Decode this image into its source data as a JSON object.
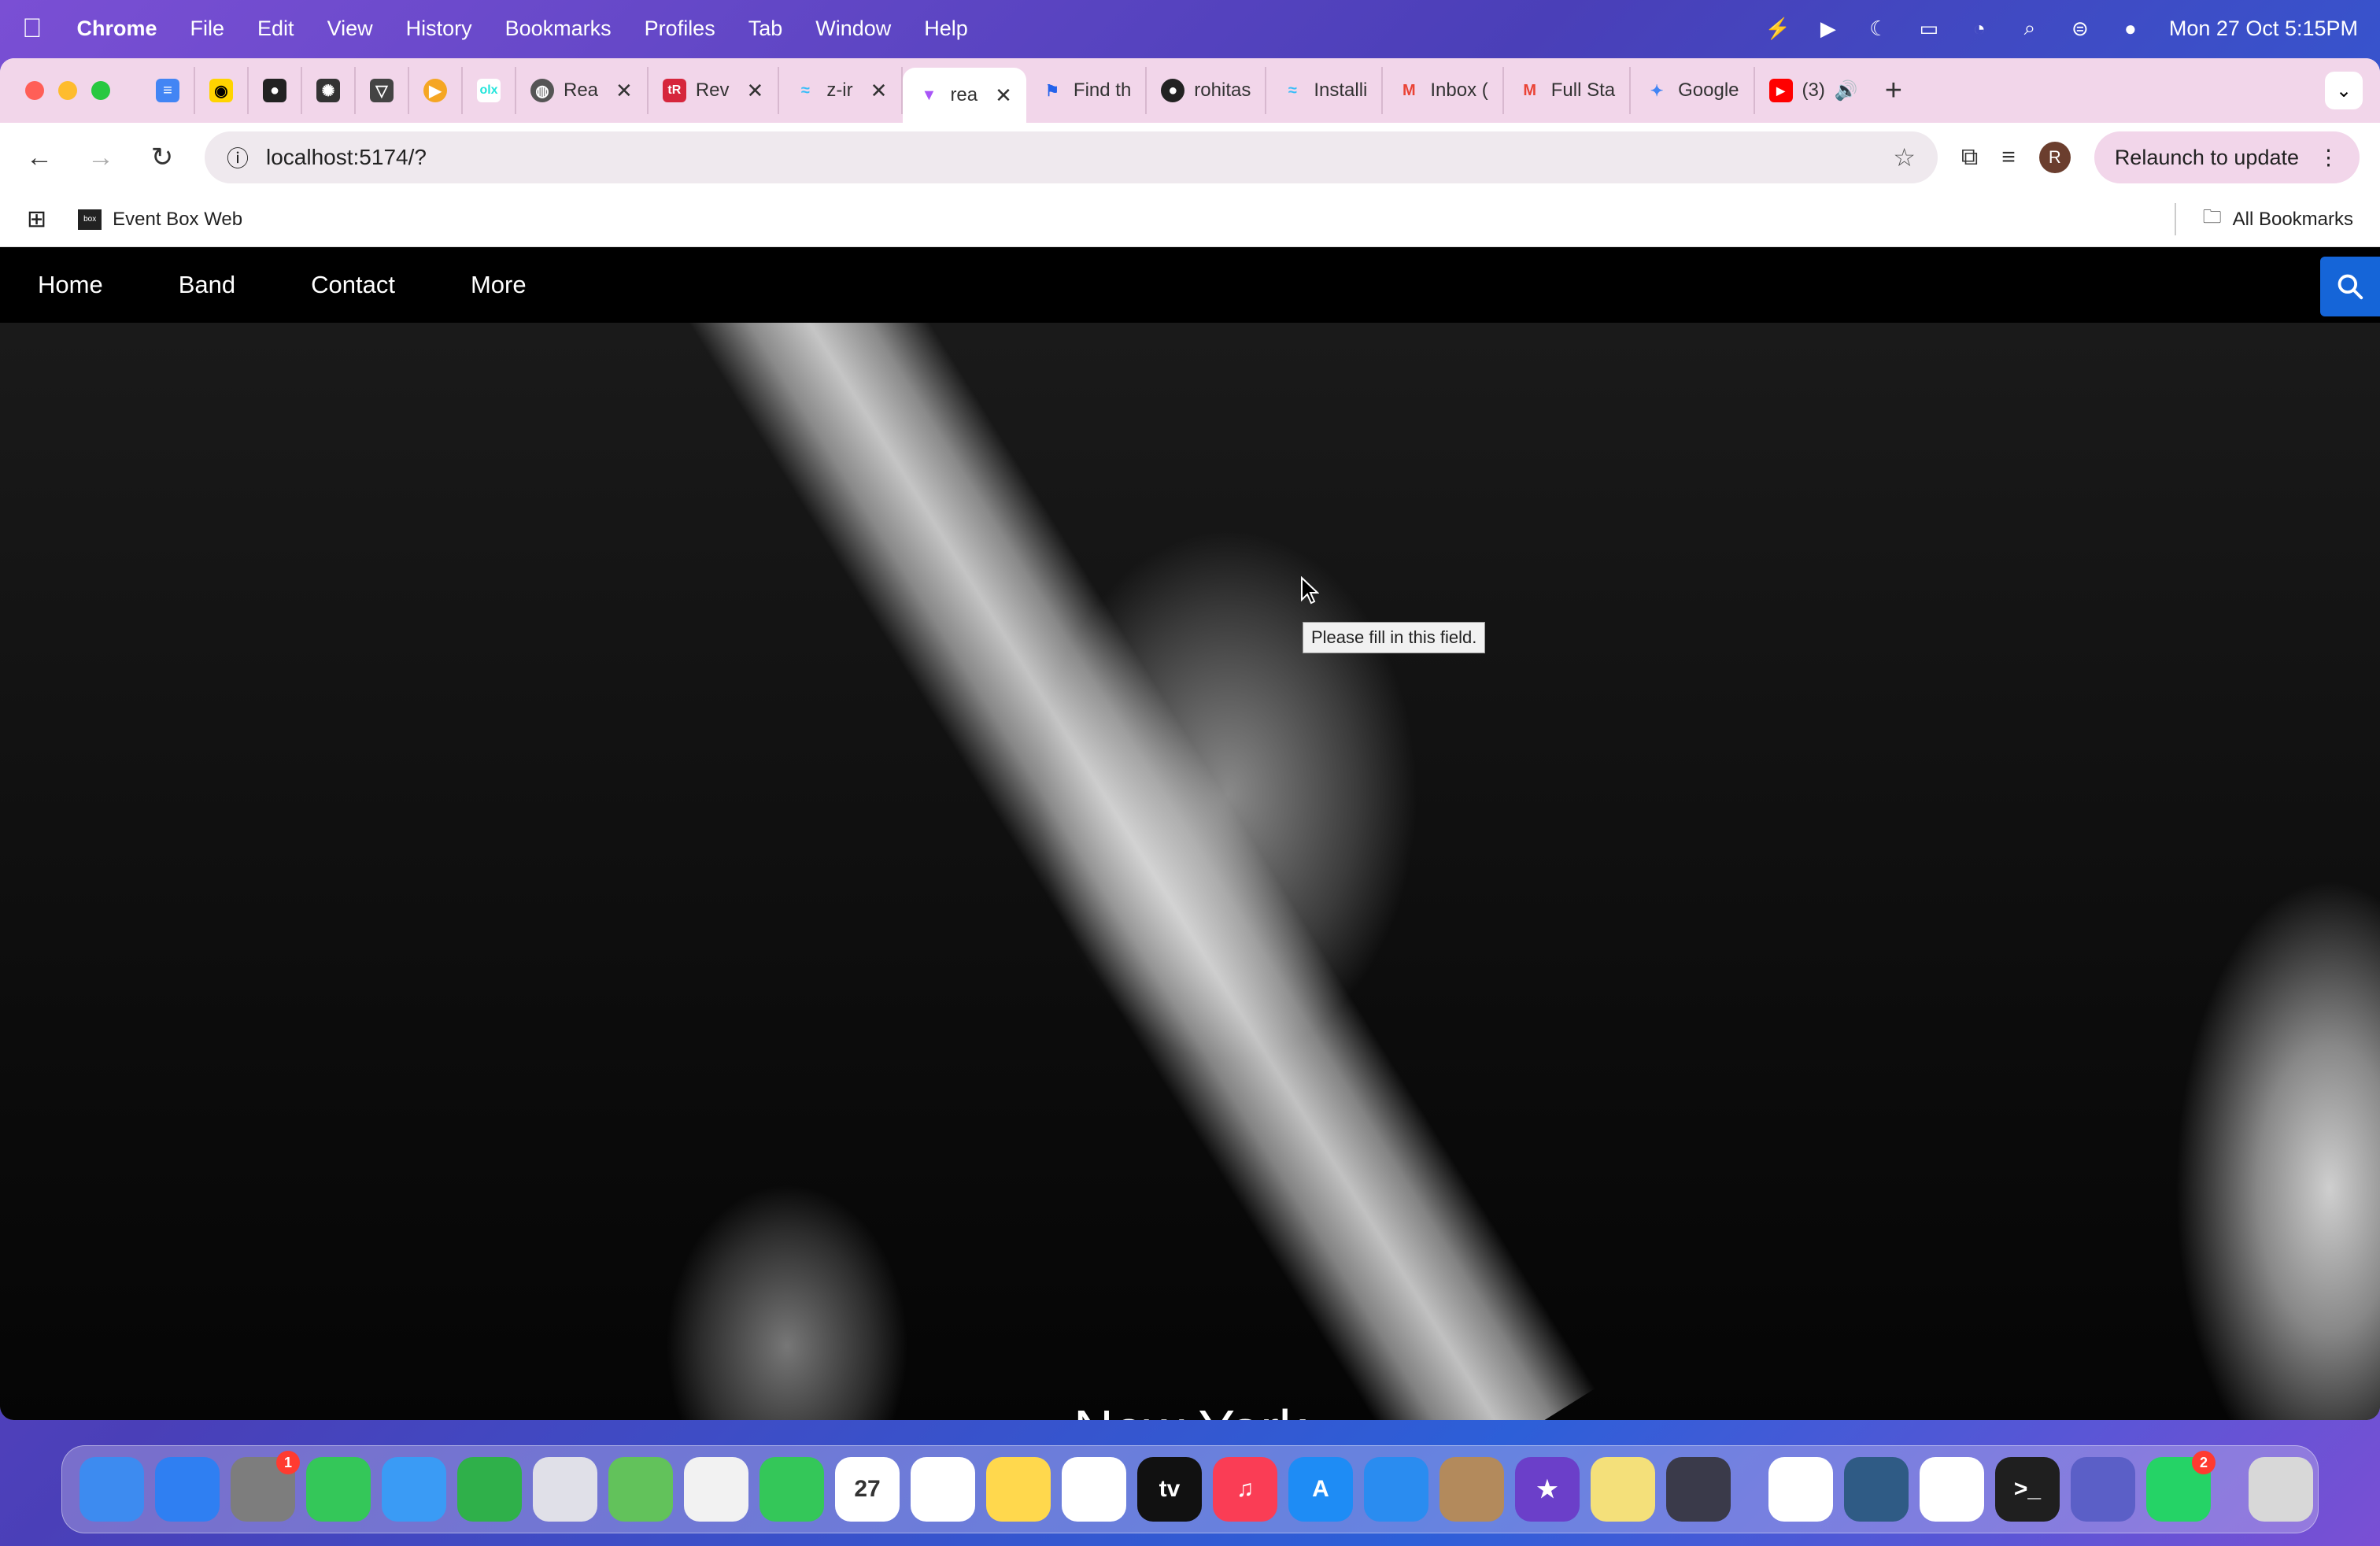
{
  "menubar": {
    "app_name": "Chrome",
    "items": [
      "File",
      "Edit",
      "View",
      "History",
      "Bookmarks",
      "Profiles",
      "Tab",
      "Window",
      "Help"
    ],
    "datetime": "Mon 27 Oct  5:15PM"
  },
  "tabs": [
    {
      "label": "",
      "icon": "docs-icon"
    },
    {
      "label": "",
      "icon": "lens-icon"
    },
    {
      "label": "",
      "icon": "github-icon"
    },
    {
      "label": "",
      "icon": "openai-icon"
    },
    {
      "label": "",
      "icon": "vercel-icon"
    },
    {
      "label": "",
      "icon": "play-icon"
    },
    {
      "label": "",
      "icon": "olx-icon"
    },
    {
      "label": "Rea",
      "icon": "globe-icon"
    },
    {
      "label": "Rev",
      "icon": "tr-icon"
    },
    {
      "label": "z-ir",
      "icon": "tailwind-icon"
    },
    {
      "label": "rea",
      "icon": "vite-icon"
    },
    {
      "label": "Find th",
      "icon": "flag-icon"
    },
    {
      "label": "rohitas",
      "icon": "github-icon"
    },
    {
      "label": "Installi",
      "icon": "tailwind-icon"
    },
    {
      "label": "Inbox (",
      "icon": "gmail-icon"
    },
    {
      "label": "Full Sta",
      "icon": "gmail-icon"
    },
    {
      "label": "Google",
      "icon": "gemini-icon"
    },
    {
      "label": "(3)",
      "icon": "youtube-icon"
    }
  ],
  "toolbar": {
    "url": "localhost:5174/?",
    "relaunch_label": "Relaunch to update",
    "avatar_letter": "R"
  },
  "bookmarks": {
    "items": [
      {
        "label": "Event Box Web"
      }
    ],
    "all_label": "All Bookmarks"
  },
  "site": {
    "nav": [
      "Home",
      "Band",
      "Contact",
      "More"
    ],
    "hero_caption": "New York",
    "tooltip": "Please fill in this field."
  },
  "dock": {
    "apps": [
      {
        "name": "finder-icon",
        "label": "",
        "color": "#3d8bf0"
      },
      {
        "name": "safari-icon",
        "label": "",
        "color": "#2f7ff2"
      },
      {
        "name": "system-settings-icon",
        "label": "",
        "color": "#7d7d7d",
        "badge": "1"
      },
      {
        "name": "messages-icon",
        "label": "",
        "color": "#34c759"
      },
      {
        "name": "mail-icon",
        "label": "",
        "color": "#3a9bf5"
      },
      {
        "name": "numbers-icon",
        "label": "",
        "color": "#2fb04a"
      },
      {
        "name": "launchpad-icon",
        "label": "",
        "color": "#e0e0e8"
      },
      {
        "name": "maps-icon",
        "label": "",
        "color": "#62c25b"
      },
      {
        "name": "photos-icon",
        "label": "",
        "color": "#f2f2f2"
      },
      {
        "name": "facetime-icon",
        "label": "",
        "color": "#34c759"
      },
      {
        "name": "calendar-icon",
        "label": "27",
        "color": "#ffffff"
      },
      {
        "name": "reminders-icon",
        "label": "",
        "color": "#ffffff"
      },
      {
        "name": "notes-icon",
        "label": "",
        "color": "#ffd84d"
      },
      {
        "name": "freeform-icon",
        "label": "",
        "color": "#ffffff"
      },
      {
        "name": "tv-icon",
        "label": "tv",
        "color": "#111111"
      },
      {
        "name": "music-icon",
        "label": "♫",
        "color": "#fa3d55"
      },
      {
        "name": "app-store-icon",
        "label": "A",
        "color": "#1e8cf5"
      },
      {
        "name": "keynote-icon",
        "label": "",
        "color": "#2a8cf0"
      },
      {
        "name": "contacts-icon",
        "label": "",
        "color": "#b38a5c"
      },
      {
        "name": "imovie-icon",
        "label": "★",
        "color": "#6b3fc9"
      },
      {
        "name": "stickies-icon",
        "label": "",
        "color": "#f4e07a"
      },
      {
        "name": "quicktime-icon",
        "label": "",
        "color": "#3a3a4a"
      },
      {
        "name": "chrome-icon",
        "label": "",
        "color": "#ffffff"
      },
      {
        "name": "mysql-workbench-icon",
        "label": "",
        "color": "#2f5b85"
      },
      {
        "name": "vscode-icon",
        "label": "",
        "color": "#ffffff"
      },
      {
        "name": "terminal-icon",
        "label": ">_",
        "color": "#1f1f1f"
      },
      {
        "name": "teams-icon",
        "label": "",
        "color": "#5b5fc7"
      },
      {
        "name": "whatsapp-icon",
        "label": "",
        "color": "#25d366",
        "badge": "2"
      },
      {
        "name": "trash-icon",
        "label": "",
        "color": "#d8d8d8"
      }
    ]
  }
}
